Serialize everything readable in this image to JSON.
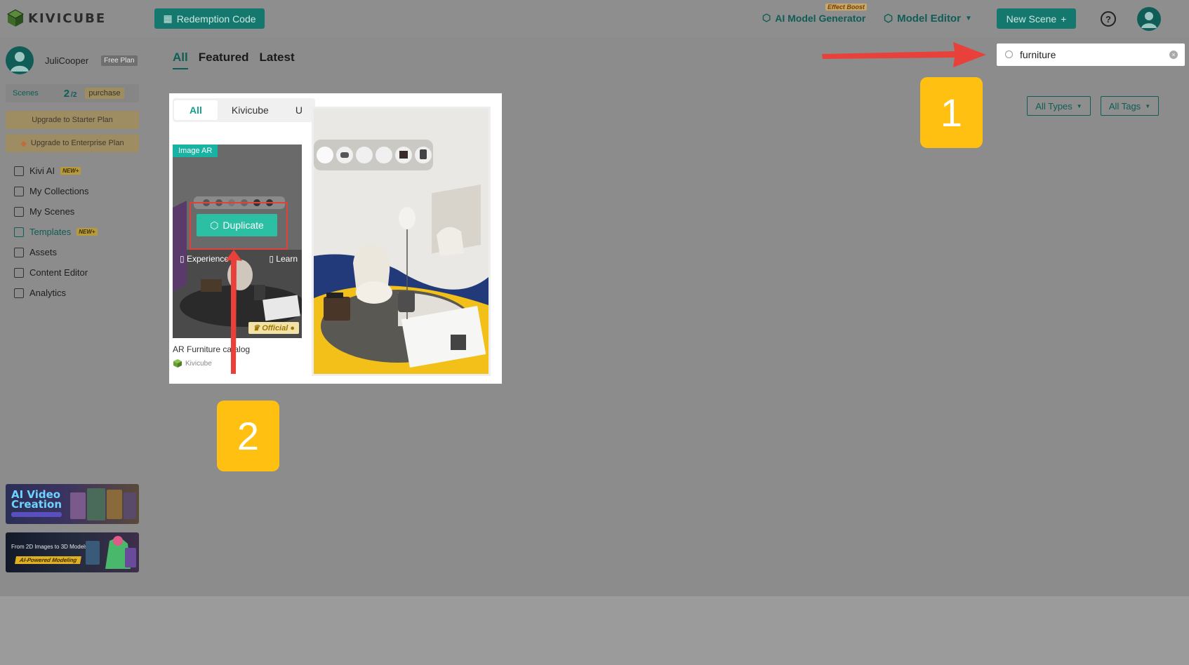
{
  "brand": {
    "name": "KIVICUBE"
  },
  "header": {
    "redeem_label": "Redemption Code",
    "ai_generator_label": "AI Model Generator",
    "effect_boost_label": "Effect Boost",
    "model_editor_label": "Model Editor",
    "new_scene_label": "New Scene",
    "help_label": "?"
  },
  "sidebar": {
    "user_name": "JuliCooper",
    "plan": "Free Plan",
    "scenes_label": "Scenes",
    "scenes_count": "2",
    "scenes_total": "/2",
    "purchase_label": "purchase",
    "upgrade_starter": "Upgrade to Starter Plan",
    "upgrade_enterprise": "Upgrade to Enterprise Plan",
    "items": [
      {
        "label": "Kivi AI",
        "badge": "NEW+"
      },
      {
        "label": "My Collections"
      },
      {
        "label": "My Scenes"
      },
      {
        "label": "Templates",
        "badge": "NEW+"
      },
      {
        "label": "Assets"
      },
      {
        "label": "Content Editor"
      },
      {
        "label": "Analytics"
      }
    ],
    "promo1_title_line1": "AI Video",
    "promo1_title_line2": "Creation",
    "promo2_title": "From 2D Images to 3D Models",
    "promo2_sub": "AI-Powered Modeling"
  },
  "main": {
    "tabs": [
      "All",
      "Featured",
      "Latest"
    ],
    "search_value": "furniture",
    "filters": {
      "types": "All Types",
      "tags": "All Tags"
    }
  },
  "popup": {
    "tabs": [
      "All",
      "Kivicube",
      "U"
    ],
    "card": {
      "type_label": "Image AR",
      "duplicate_label": "Duplicate",
      "experience_label": "Experience",
      "learn_label": "Learn",
      "official_label": "Official",
      "title": "AR Furniture catalog",
      "author": "Kivicube"
    }
  },
  "callouts": {
    "one": "1",
    "two": "2"
  },
  "colors": {
    "accent": "#0f5d56",
    "callout": "#ffc012",
    "arrow": "#e2403a",
    "duplicate": "#2bbfa4"
  }
}
